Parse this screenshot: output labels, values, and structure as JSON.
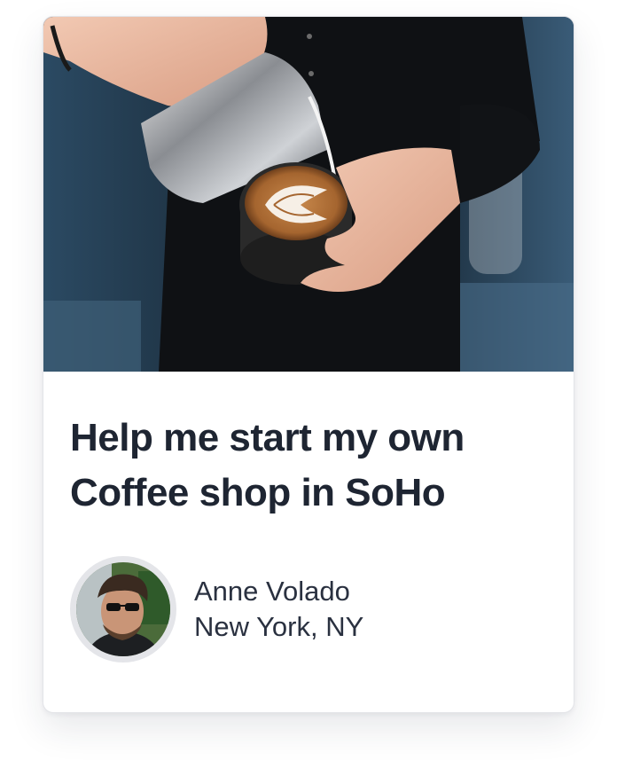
{
  "card": {
    "image_alt": "Barista pouring latte art into a coffee cup",
    "title": "Help me start my own Coffee shop in SoHo",
    "author": {
      "name": "Anne Volado",
      "location": "New York, NY"
    }
  },
  "colors": {
    "title": "#1e2532",
    "text": "#2a3140",
    "card_border": "#e3e4e8",
    "avatar_ring": "#e4e5e9"
  }
}
